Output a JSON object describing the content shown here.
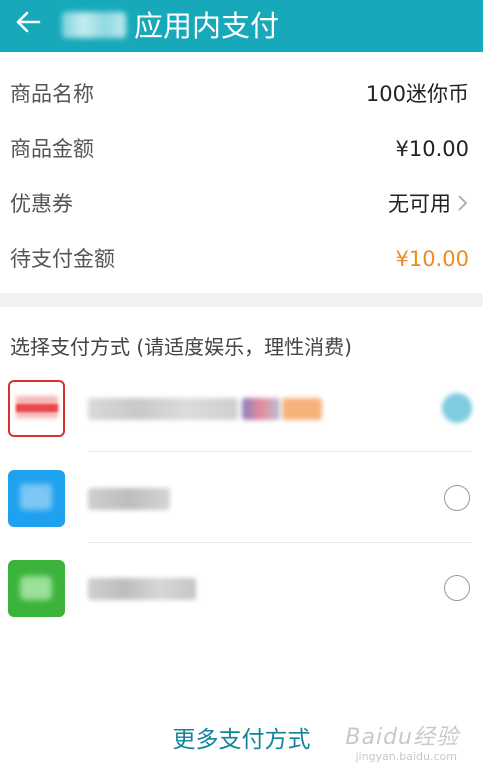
{
  "header": {
    "title": "应用内支付",
    "back_icon": "arrow-left-icon",
    "background": "#17a9b9"
  },
  "order": {
    "product_name_label": "商品名称",
    "product_name_value": "100迷你币",
    "amount_label": "商品金额",
    "amount_value": "¥10.00",
    "coupon_label": "优惠券",
    "coupon_value": "无可用",
    "due_label": "待支付金额",
    "due_value": "¥10.00",
    "due_color": "#f08a24"
  },
  "payment": {
    "section_title": "选择支付方式 (请适度娱乐，理性消费)",
    "methods": [
      {
        "icon": "card-payment-icon",
        "selected": true
      },
      {
        "icon": "alipay-icon",
        "selected": false
      },
      {
        "icon": "wechat-pay-icon",
        "selected": false
      }
    ]
  },
  "footer": {
    "more_label": "更多支付方式",
    "more_color": "#12849a"
  },
  "watermark": {
    "text": "Baidu经验",
    "sub": "jingyan.baidu.com"
  }
}
